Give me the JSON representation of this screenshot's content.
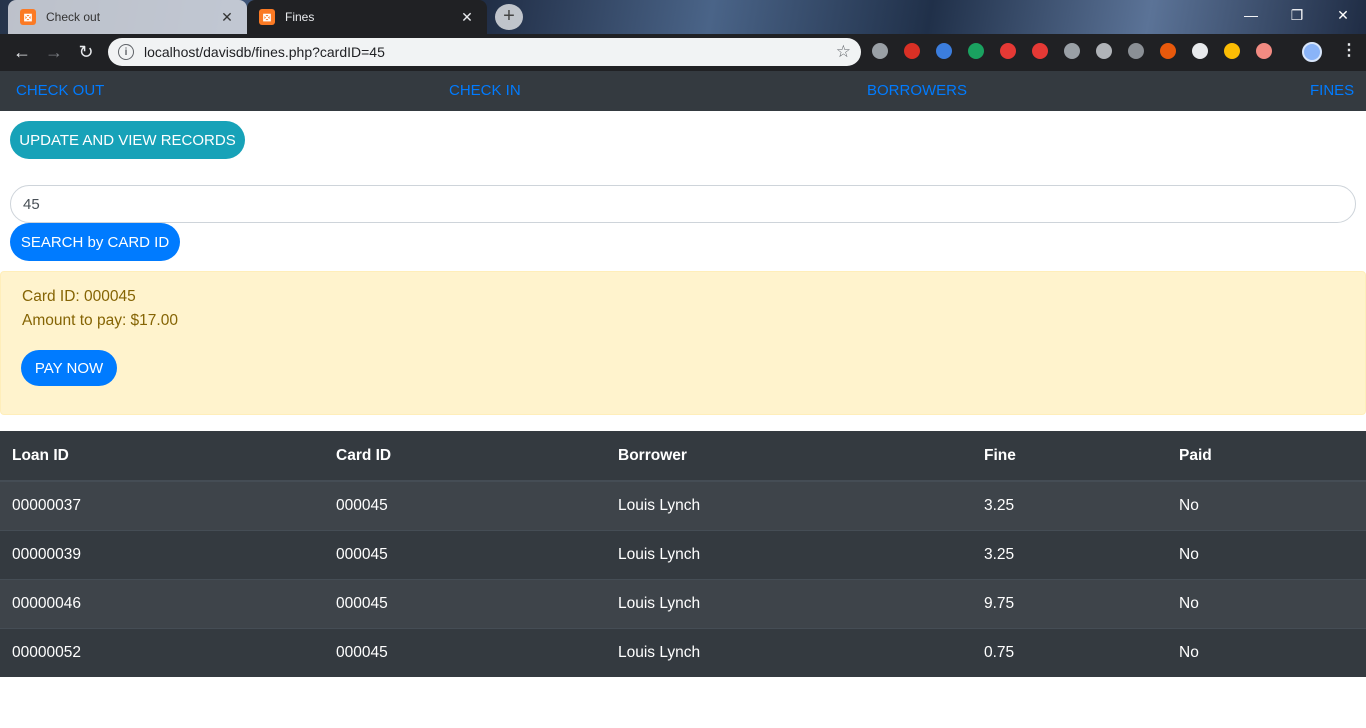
{
  "browser": {
    "tabs": [
      {
        "title": "Check out",
        "active": false
      },
      {
        "title": "Fines",
        "active": true
      }
    ],
    "url": "localhost/davisdb/fines.php?cardID=45",
    "window_controls": {
      "minimize": "—",
      "restore": "❐",
      "close": "✕"
    },
    "extension_colors": [
      "#9aa0a6",
      "#d93025",
      "#3b7ddd",
      "#1aa260",
      "#e53935",
      "#e53935",
      "#9aa0a6",
      "#b0b3b8",
      "#8a8f95",
      "#e8590c",
      "#e8eaed",
      "#fbbc04",
      "#f28b82"
    ]
  },
  "nav": {
    "checkout": "CHECK OUT",
    "checkin": "CHECK IN",
    "borrowers": "BORROWERS",
    "fines": "FINES"
  },
  "update_button": "UPDATE AND VIEW RECORDS",
  "search": {
    "value": "45",
    "button": "SEARCH by CARD ID"
  },
  "summary": {
    "card_line": "Card ID: 000045",
    "amount_line": "Amount to pay: $17.00",
    "pay_button": "PAY NOW"
  },
  "table": {
    "headers": [
      "Loan ID",
      "Card ID",
      "Borrower",
      "Fine",
      "Paid"
    ],
    "rows": [
      [
        "00000037",
        "000045",
        "Louis Lynch",
        "3.25",
        "No"
      ],
      [
        "00000039",
        "000045",
        "Louis Lynch",
        "3.25",
        "No"
      ],
      [
        "00000046",
        "000045",
        "Louis Lynch",
        "9.75",
        "No"
      ],
      [
        "00000052",
        "000045",
        "Louis Lynch",
        "0.75",
        "No"
      ]
    ]
  },
  "colors": {
    "nav_bg": "#343a40",
    "link": "#007bff",
    "info": "#17a2b8",
    "warning_bg": "#fff3cd",
    "warning_text": "#856404"
  }
}
